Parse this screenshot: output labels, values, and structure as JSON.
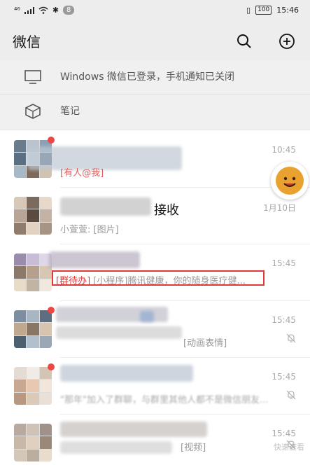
{
  "status_bar": {
    "signal": "⁴⁶",
    "notification_count": "8",
    "battery": "100",
    "time": "15:46"
  },
  "header": {
    "title": "微信",
    "search_icon": "search-icon",
    "add_icon": "plus-circle-icon"
  },
  "notices": [
    {
      "icon": "monitor-icon",
      "text": "Windows 微信已登录，手机通知已关闭"
    },
    {
      "icon": "cube-icon",
      "text": "笔记"
    }
  ],
  "chats": [
    {
      "time": "10:45",
      "message": "[有人@我]",
      "has_dot": true,
      "muted": false
    },
    {
      "name_suffix": "接收",
      "time": "1月10日",
      "message": "小萱萱: [图片]",
      "has_dot": false,
      "muted": false
    },
    {
      "time": "15:45",
      "message_tag": "[群待办]",
      "message": "[小程序]腾讯健康，你的随身医疗健...",
      "has_dot": false,
      "muted": false
    },
    {
      "time": "15:45",
      "message": "[动画表情]",
      "has_dot": true,
      "muted": true
    },
    {
      "time": "15:45",
      "message": "\"那年\"加入了群聊，与群里其他人都不是微信朋友...",
      "has_dot": true,
      "muted": true
    },
    {
      "time": "15:45",
      "message": "[视频]",
      "has_dot": false,
      "muted": true
    }
  ],
  "watermark": "快速查看",
  "colors": {
    "accent_red": "#e03b3b",
    "badge_red": "#f04545",
    "bar_bg": "#ededed"
  }
}
